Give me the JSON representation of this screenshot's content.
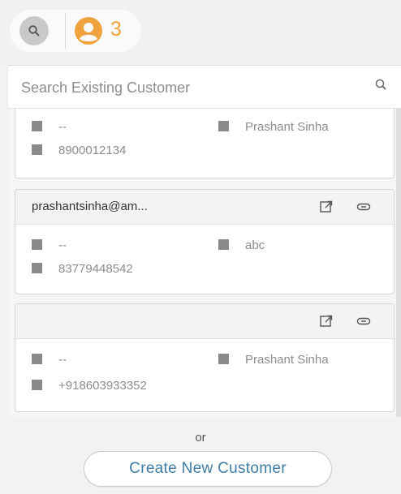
{
  "header": {
    "search_icon": "search-icon",
    "user_icon": "user-circle-icon",
    "customer_count": "3",
    "accent_color": "#f0a23c"
  },
  "search": {
    "placeholder": "Search Existing Customer",
    "value": ""
  },
  "customers": [
    {
      "email": "",
      "field_left": "--",
      "name": "Prashant Sinha",
      "phone": "8900012134"
    },
    {
      "email": "prashantsinha@am...",
      "field_left": "--",
      "name": "abc",
      "phone": "83779448542"
    },
    {
      "email": "",
      "field_left": "--",
      "name": "Prashant Sinha",
      "phone": "+918603933352"
    }
  ],
  "footer": {
    "or_label": "or",
    "create_label": "Create New Customer"
  }
}
